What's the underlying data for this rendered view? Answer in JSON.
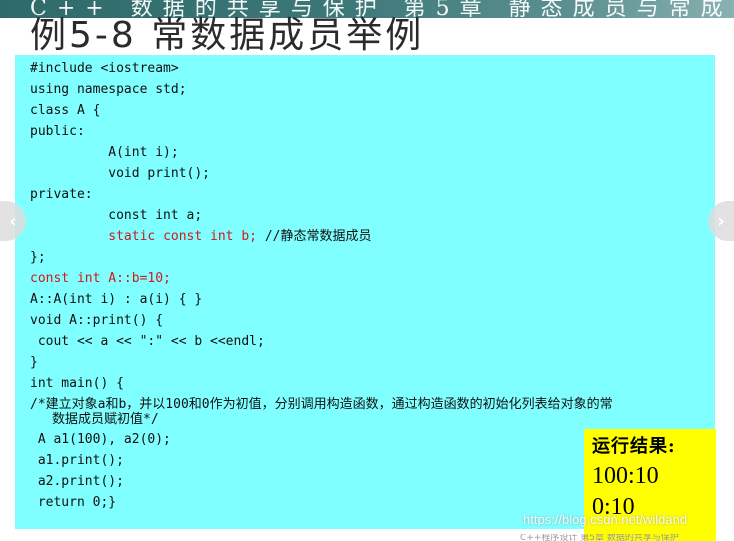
{
  "banner": {
    "text": "C++ 数据的共享与保护 第5章 静态成员与常成员"
  },
  "title": "例5-8  常数据成员举例",
  "code": {
    "l1": "#include <iostream>",
    "l2": "using namespace std;",
    "l3": "class A {",
    "l4": "public:",
    "l5": "          A(int i);",
    "l6": "          void print();",
    "l7": "private:",
    "l8": "          const int a;",
    "l9_indent": "          ",
    "l9_red": "static const int b;",
    "l9_comment": " //静态常数据成员",
    "l10": "};",
    "l11": "const int A::b=10;",
    "l12": "A::A(int i) : a(i) { }",
    "l13": "void A::print() {",
    "l14": " cout << a << \":\" << b <<endl;",
    "l15": "}",
    "l16": "int main() {",
    "l17": "/*建立对象a和b，并以100和0作为初值，分别调用构造函数，通过构造函数的初始化列表给对象的常",
    "l18": "数据成员赋初值*/",
    "l19": " A a1(100), a2(0);",
    "l20": " a1.print();",
    "l21": " a2.print();",
    "l22": " return 0;}"
  },
  "result": {
    "title": "运行结果:",
    "line1": "100:10",
    "line2": "0:10"
  },
  "nav": {
    "prev_icon": "chevron-left-icon",
    "next_icon": "chevron-right-icon",
    "prev_glyph": "‹",
    "next_glyph": "›"
  },
  "watermark": "https://blog.csdn.net/wildand",
  "footnote": "C++程序设计 第5章 数据的共享与保护",
  "colors": {
    "panel": "#7fffff",
    "result_bg": "#ffff00",
    "red_code": "#d11a1a",
    "banner": "#2f6a6a"
  }
}
